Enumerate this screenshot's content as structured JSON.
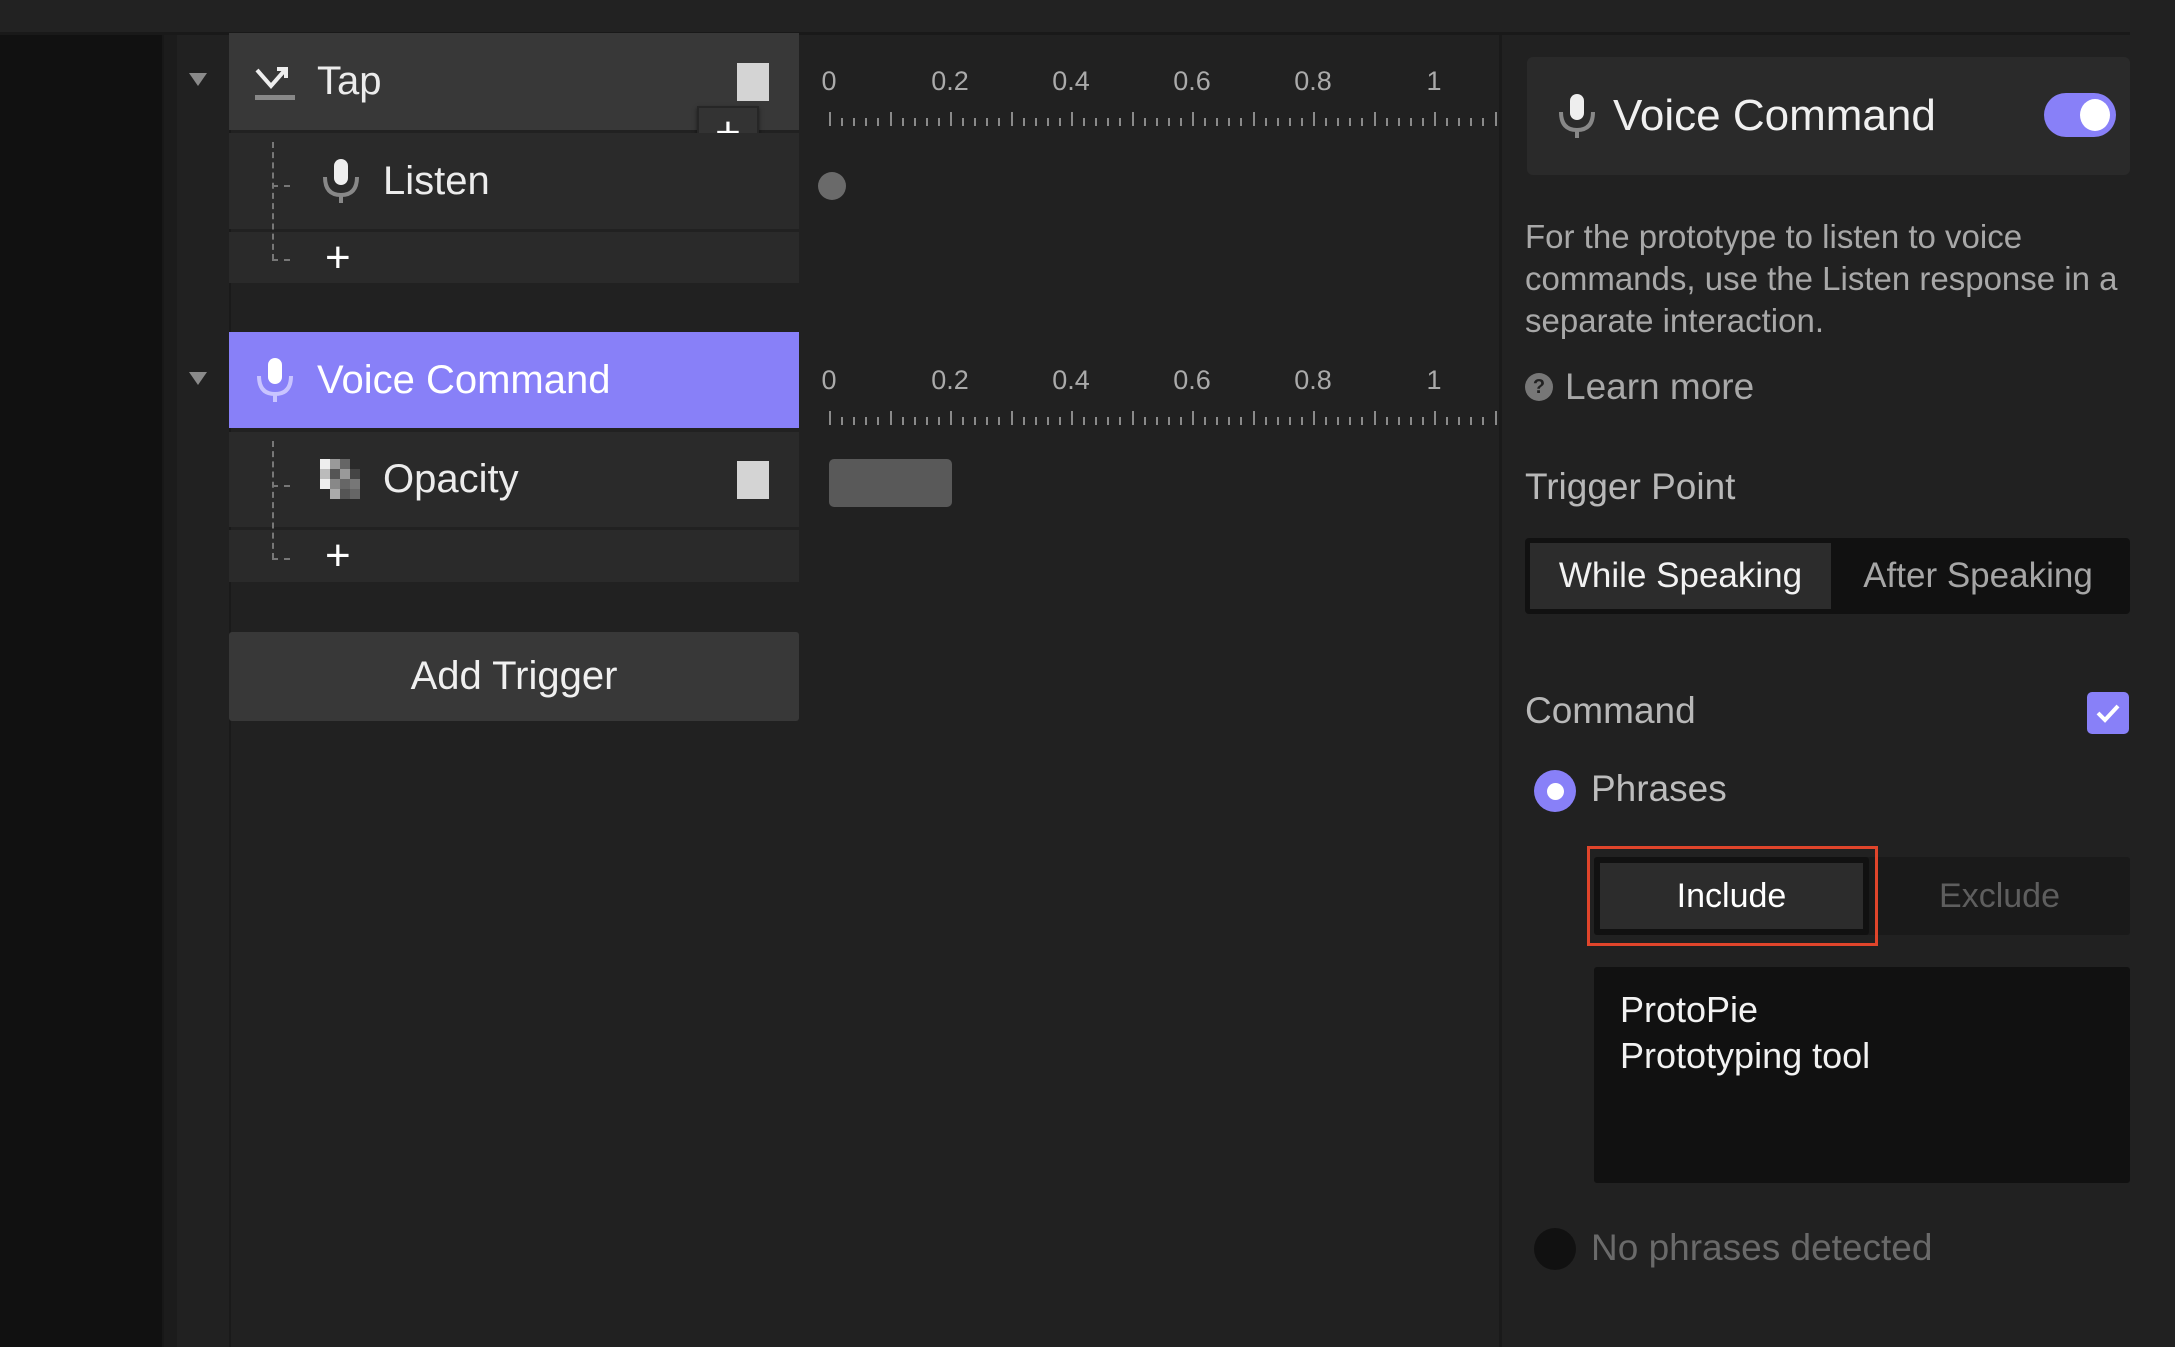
{
  "timeline": {
    "labels": [
      "0",
      "0.2",
      "0.4",
      "0.6",
      "0.8",
      "1"
    ],
    "range_seconds": [
      0,
      1.1
    ],
    "major_tick_step": 0.1,
    "minor_per_major": 5
  },
  "interactions": [
    {
      "trigger": {
        "label": "Tap",
        "icon": "tap-icon",
        "selected": false,
        "collapsed": false
      },
      "responses": [
        {
          "label": "Listen",
          "icon": "microphone-icon",
          "start": 0,
          "duration": 0
        }
      ]
    },
    {
      "trigger": {
        "label": "Voice Command",
        "icon": "microphone-icon",
        "selected": true,
        "collapsed": false
      },
      "responses": [
        {
          "label": "Opacity",
          "icon": "opacity-checker-icon",
          "start": 0,
          "duration": 0.2
        }
      ]
    }
  ],
  "add_response_symbol": "+",
  "add_trigger_label": "Add Trigger",
  "panel": {
    "title": "Voice Command",
    "enabled": true,
    "description": "For the prototype to listen to voice commands, use the Listen response in a separate interaction.",
    "learn_more": "Learn more",
    "trigger_point": {
      "label": "Trigger Point",
      "options": [
        "While Speaking",
        "After Speaking"
      ],
      "selected": "While Speaking"
    },
    "command": {
      "label": "Command",
      "checked": true,
      "phrases_option": "Phrases",
      "phrases_selected": true,
      "mode_options": [
        "Include",
        "Exclude"
      ],
      "mode_selected": "Include",
      "phrases_text_lines": [
        "ProtoPie",
        "Prototyping tool"
      ],
      "no_phrases_option": "No phrases detected",
      "no_phrases_selected": false
    }
  },
  "colors": {
    "accent": "#8880f8",
    "highlight_border": "#e0452b",
    "background": "#212121"
  }
}
